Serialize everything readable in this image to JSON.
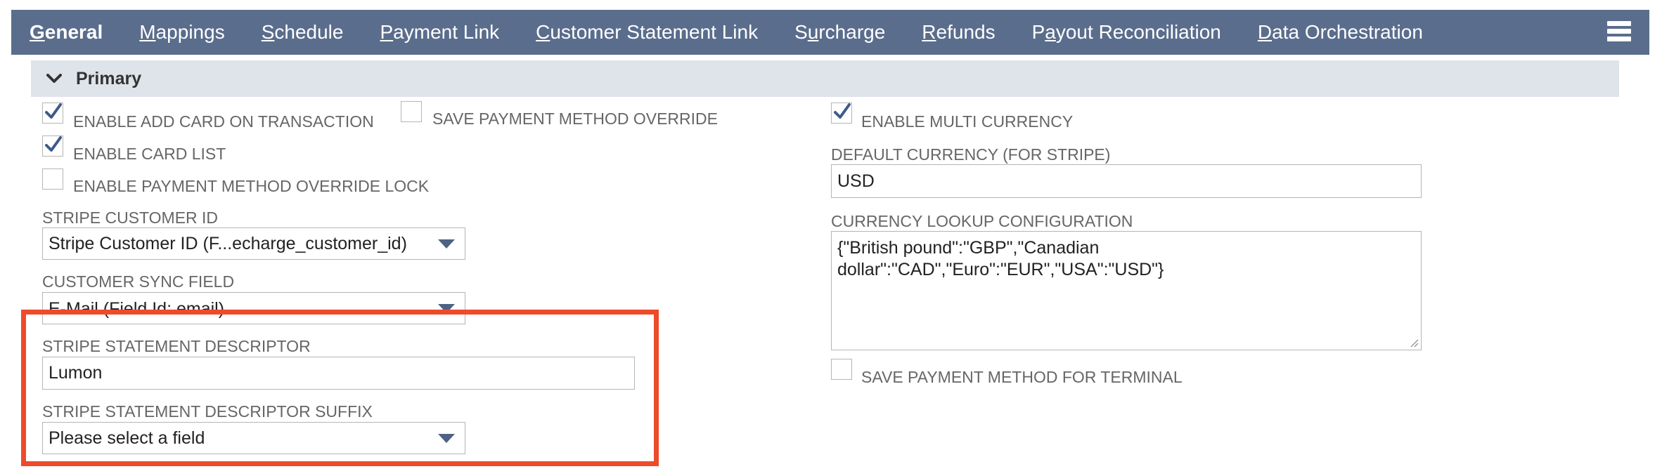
{
  "tabs": [
    {
      "first": "G",
      "rest": "eneral",
      "active": true
    },
    {
      "first": "M",
      "rest": "appings"
    },
    {
      "first": "S",
      "rest": "chedule"
    },
    {
      "first": "P",
      "rest": "ayment Link"
    },
    {
      "first": "C",
      "rest": "ustomer Statement Link"
    },
    {
      "pre": "S",
      "first": "u",
      "rest": "rcharge"
    },
    {
      "first": "R",
      "rest": "efunds"
    },
    {
      "pre": "P",
      "first": "a",
      "rest": "yout Reconciliation"
    },
    {
      "first": "D",
      "rest": "ata Orchestration"
    }
  ],
  "section": {
    "title": "Primary"
  },
  "left": {
    "enable_add_card": {
      "label": "ENABLE ADD CARD ON TRANSACTION",
      "checked": true
    },
    "save_pm_override": {
      "label": "SAVE PAYMENT METHOD OVERRIDE",
      "checked": false
    },
    "enable_card_list": {
      "label": "ENABLE CARD LIST",
      "checked": true
    },
    "enable_pm_override_lock": {
      "label": "ENABLE PAYMENT METHOD OVERRIDE LOCK",
      "checked": false
    },
    "stripe_customer_id": {
      "label": "STRIPE CUSTOMER ID",
      "value": "Stripe Customer ID (F...echarge_customer_id)"
    },
    "customer_sync_field": {
      "label": "CUSTOMER SYNC FIELD",
      "value": "E-Mail (Field Id: email)"
    },
    "statement_descriptor": {
      "label": "STRIPE STATEMENT DESCRIPTOR",
      "value": "Lumon"
    },
    "statement_descriptor_suffix": {
      "label": "STRIPE STATEMENT DESCRIPTOR SUFFIX",
      "value": "Please select a field"
    }
  },
  "right": {
    "enable_multi_currency": {
      "label": "ENABLE MULTI CURRENCY",
      "checked": true
    },
    "default_currency": {
      "label": "DEFAULT CURRENCY (FOR STRIPE)",
      "value": "USD"
    },
    "currency_lookup": {
      "label": "CURRENCY LOOKUP CONFIGURATION",
      "value": "{\"British pound\":\"GBP\",\"Canadian\ndollar\":\"CAD\",\"Euro\":\"EUR\",\"USA\":\"USD\"}"
    },
    "save_pm_terminal": {
      "label": "SAVE PAYMENT METHOD FOR TERMINAL",
      "checked": false
    }
  },
  "colors": {
    "tabbar": "#5a6d8c",
    "section": "#dfe4eb",
    "highlight": "#ee4b2b",
    "check": "#3d5a8a"
  }
}
